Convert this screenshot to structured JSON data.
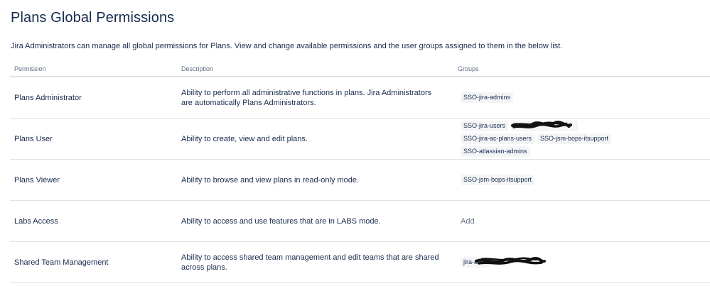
{
  "page": {
    "title": "Plans Global Permissions",
    "intro": "Jira Administrators can manage all global permissions for Plans. View and change available permissions and the user groups assigned to them in the below list."
  },
  "table": {
    "headers": [
      "Permission",
      "Description",
      "Groups"
    ],
    "rows": [
      {
        "permission": "Plans Administrator",
        "description": "Ability to perform all administrative functions in plans. Jira Administrators are automatically Plans Administrators.",
        "groups": [
          "SSO-jira-admins"
        ]
      },
      {
        "permission": "Plans User",
        "description": "Ability to create, view and edit plans.",
        "groups": [
          "SSO-jira-users",
          "",
          "SSO-jira-ac-plans-users",
          "SSO-jsm-bops-itsupport",
          "SSO-atlassian-admins"
        ]
      },
      {
        "permission": "Plans Viewer",
        "description": "Ability to browse and view plans in read-only mode.",
        "groups": [
          "SSO-jsm-bops-itsupport"
        ]
      },
      {
        "permission": "Labs Access",
        "description": "Ability to access and use features that are in LABS mode.",
        "add_label": "Add"
      },
      {
        "permission": "Shared Team Management",
        "description": "Ability to access shared team management and edit teams that are shared across plans.",
        "groups": [
          "jira-adm"
        ]
      }
    ]
  },
  "colors": {
    "text": "#172b4d",
    "muted": "#5e6c84",
    "lozenge_bg": "#f4f5f7",
    "divider": "#dfe1e6",
    "redaction": "#111111"
  }
}
